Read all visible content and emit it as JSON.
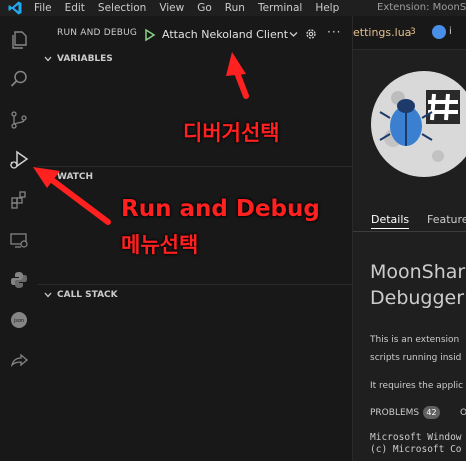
{
  "menubar": {
    "items": [
      "File",
      "Edit",
      "Selection",
      "View",
      "Go",
      "Run",
      "Terminal",
      "Help"
    ],
    "window_title": "Extension: MoonSha"
  },
  "debug": {
    "view_title": "RUN AND DEBUG",
    "config": "Attach Nekoland Client",
    "more": "···",
    "sections": [
      "VARIABLES",
      "WATCH",
      "CALL STACK"
    ]
  },
  "tabs": {
    "settings_tab": "ettings.lua",
    "settings_badge": "3",
    "lua_tab": "i"
  },
  "extension": {
    "tabs": [
      "Details",
      "Feature"
    ],
    "name_line1": "MoonShar",
    "name_line2": "Debugger",
    "desc_line1": "This is an extension",
    "desc_line2": "scripts running insid",
    "desc_line3": "It requires the applic",
    "panel_problems": "PROBLEMS",
    "panel_problems_count": "42",
    "panel_next": "O",
    "terminal_line1": "Microsoft Window",
    "terminal_line2": "(c) Microsoft Co"
  },
  "annotations": {
    "debugger_select": "디버거선택",
    "run_debug_line1": "Run and Debug",
    "run_debug_line2": "메뉴선택"
  },
  "colors": {
    "annotation": "#ff2020",
    "accent": "#0078d4",
    "tab_modified": "#e2c08d"
  }
}
